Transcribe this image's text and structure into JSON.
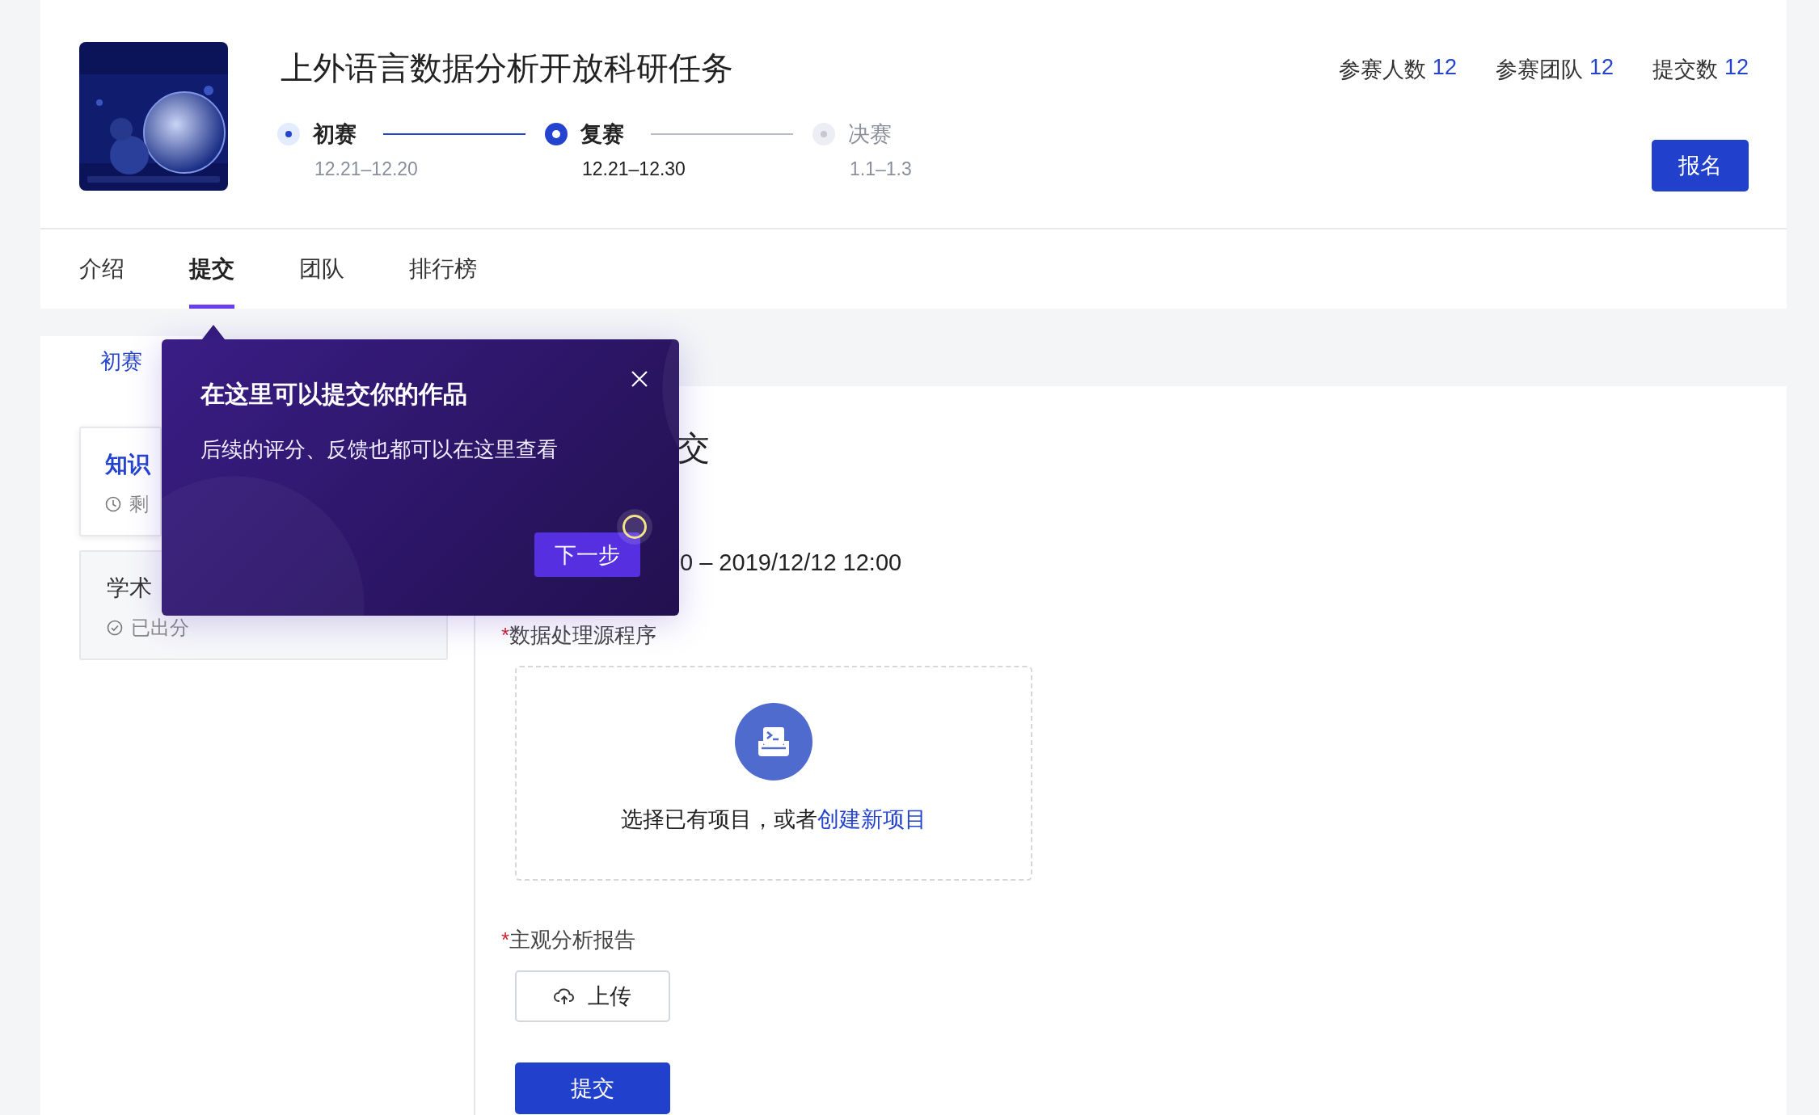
{
  "competition": {
    "title": "上外语言数据分析开放科研任务",
    "stages": [
      {
        "name": "初赛",
        "dates": "12.21–12.20",
        "kind": "done"
      },
      {
        "name": "复赛",
        "dates": "12.21–12.30",
        "kind": "current"
      },
      {
        "name": "决赛",
        "dates": "1.1–1.3",
        "kind": "upcoming"
      }
    ],
    "stats": [
      {
        "label": "参赛人数",
        "value": "12"
      },
      {
        "label": "参赛团队",
        "value": "12"
      },
      {
        "label": "提交数",
        "value": "12"
      }
    ],
    "signup_button": "报名"
  },
  "tabs": [
    {
      "label": "介绍",
      "selected": false
    },
    {
      "label": "提交",
      "selected": true
    },
    {
      "label": "团队",
      "selected": false
    },
    {
      "label": "排行榜",
      "selected": false
    }
  ],
  "stage_tabs": [
    {
      "label": "初赛",
      "selected": true
    }
  ],
  "task_cards": [
    {
      "title": "知识",
      "kind": "pending",
      "status": "剩",
      "selected": true
    },
    {
      "title": "学术",
      "kind": "scored",
      "status": "已出分",
      "selected": false
    }
  ],
  "submission": {
    "title": "交",
    "period": "0 – 2019/12/12 12:00",
    "fields": [
      {
        "kind": "project",
        "required_mark": "*",
        "label": "数据处理源程序",
        "prompt": "选择已有项目，或者",
        "link": "创建新项目"
      },
      {
        "kind": "upload",
        "required_mark": "*",
        "label": "主观分析报告",
        "button": "上传"
      }
    ],
    "submit_button": "提交"
  },
  "guide_popover": {
    "title": "在这里可以提交你的作品",
    "body": "后续的评分、反馈也都可以在这里查看",
    "next_button": "下一步"
  }
}
